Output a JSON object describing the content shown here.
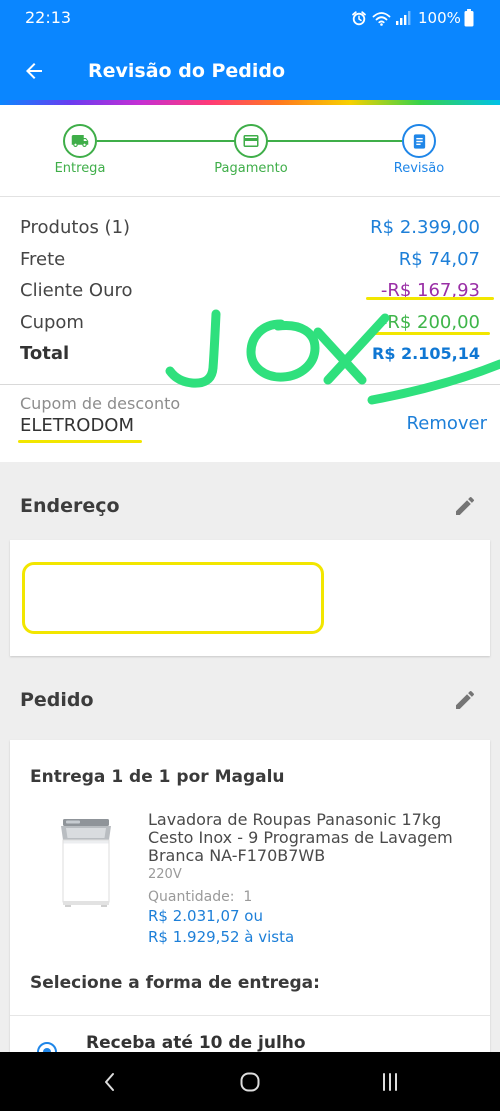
{
  "status_bar": {
    "time": "22:13",
    "battery_text": "100%",
    "icons": [
      "alarm-icon",
      "wifi-icon",
      "signal-icon",
      "battery-icon"
    ]
  },
  "app_bar": {
    "title": "Revisão do Pedido",
    "back_icon": "arrow-back-icon"
  },
  "stepper": {
    "steps": [
      {
        "label": "Entrega",
        "icon": "truck-icon",
        "state": "done"
      },
      {
        "label": "Pagamento",
        "icon": "credit-card-icon",
        "state": "done"
      },
      {
        "label": "Revisão",
        "icon": "document-icon",
        "state": "current"
      }
    ]
  },
  "summary": {
    "rows": [
      {
        "label": "Produtos (1)",
        "value": "R$ 2.399,00"
      },
      {
        "label": "Frete",
        "value": "R$ 74,07"
      },
      {
        "label": "Cliente Ouro",
        "value": "-R$ 167,93"
      },
      {
        "label": "Cupom",
        "value": "-R$ 200,00"
      }
    ],
    "total": {
      "label": "Total",
      "value": "R$ 2.105,14"
    }
  },
  "coupon": {
    "label": "Cupom de desconto",
    "code": "ELETRODOM",
    "remove_label": "Remover"
  },
  "address": {
    "title": "Endereço",
    "edit_icon": "pencil-icon"
  },
  "order": {
    "title": "Pedido",
    "edit_icon": "pencil-icon",
    "delivery_title": "Entrega 1 de 1 por Magalu",
    "product": {
      "image_icon": "washing-machine-icon",
      "name": "Lavadora de Roupas Panasonic 17kg Cesto Inox - 9 Programas de Lavagem Branca NA-F170B7WB",
      "voltage": "220V",
      "quantity_label": "Quantidade:",
      "quantity": "1",
      "price_installments": "R$ 2.031,07 ou",
      "price_cash": "R$ 1.929,52 à vista"
    },
    "shipping_prompt": "Selecione a forma de entrega:",
    "shipping_options": [
      {
        "label": "Receba até 10 de julho"
      }
    ]
  },
  "annotations": {
    "handwritten_text": "JOX",
    "ink_color": "#2fe07d",
    "highlight_color": "#f2e600"
  },
  "nav_bar": {
    "icons": [
      "nav-back-icon",
      "nav-home-icon",
      "nav-recents-icon"
    ]
  },
  "colors": {
    "brand_blue": "#0a86ff",
    "price_blue": "#1d7fd8",
    "step_done_green": "#3fae49",
    "step_current_blue": "#1f86e8",
    "gold_discount_purple": "#9a2fa6",
    "coupon_discount_green": "#3fb54a",
    "section_gray": "#eeeeee"
  }
}
